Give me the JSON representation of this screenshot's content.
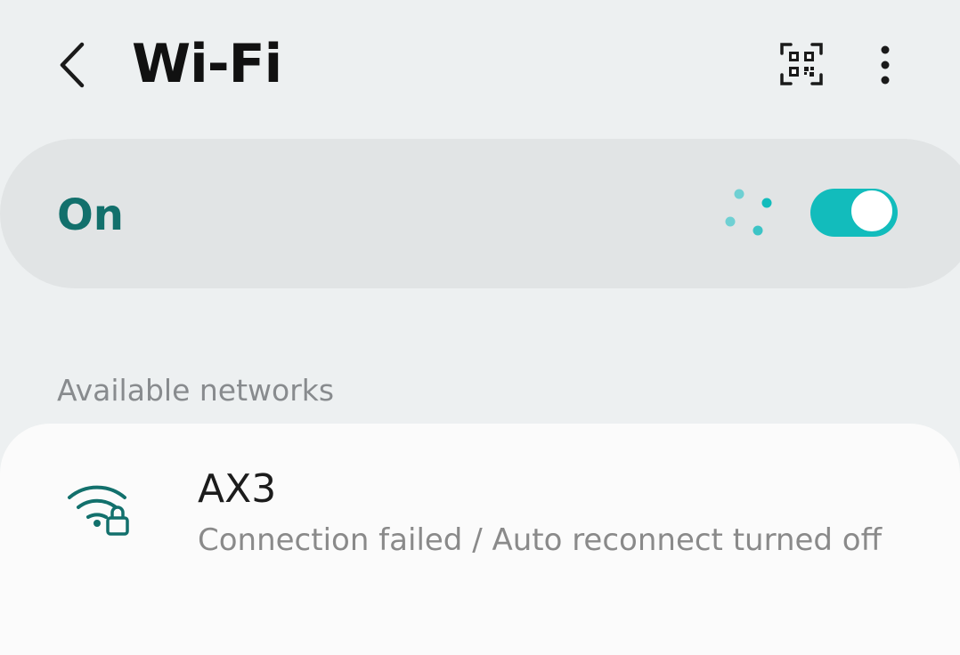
{
  "header": {
    "title": "Wi-Fi",
    "back_icon": "chevron-left-icon",
    "qr_icon": "qr-code-scan-icon",
    "more_icon": "more-vertical-icon"
  },
  "master_toggle": {
    "label": "On",
    "state": "on",
    "scanning": true,
    "accent_color": "#12bcbc"
  },
  "networks": {
    "section_title": "Available networks",
    "items": [
      {
        "name": "AX3",
        "status": "Connection failed / Auto reconnect turned off",
        "icon": "wifi-lock-icon",
        "secured": true
      }
    ]
  },
  "colors": {
    "background": "#edf0f1",
    "toggle_card": "#e1e4e5",
    "label_teal": "#12706c",
    "accent": "#12bcbc",
    "secondary_text": "#888b8e"
  }
}
